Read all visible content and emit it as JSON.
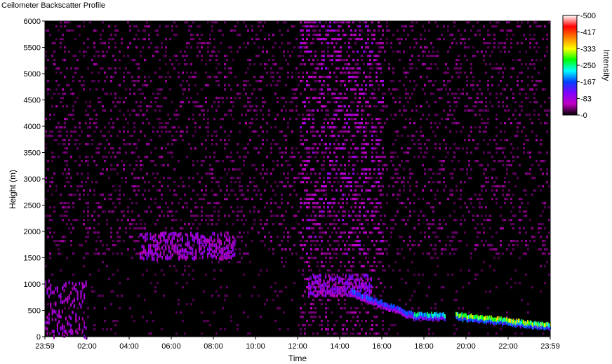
{
  "window": {
    "title": "Ceilometer Backscatter Profile"
  },
  "chart_data": {
    "type": "heatmap",
    "xlabel": "Time",
    "ylabel": "Height (m)",
    "x_ticks": [
      "23:59",
      "02:00",
      "04:00",
      "06:00",
      "08:00",
      "10:00",
      "12:00",
      "14:00",
      "16:00",
      "18:00",
      "20:00",
      "22:00",
      "23:59"
    ],
    "y_ticks": [
      0,
      500,
      1000,
      1500,
      2000,
      2500,
      3000,
      3500,
      4000,
      4500,
      5000,
      5500,
      6000
    ],
    "ylim": [
      0,
      6000
    ],
    "xlim_hours": [
      0,
      24
    ],
    "colorbar": {
      "label": "Intensity",
      "ticks": [
        0,
        83,
        167,
        250,
        333,
        417,
        500
      ],
      "range": [
        0,
        500
      ],
      "colors": [
        "#000000",
        "#c000c0",
        "#8000ff",
        "#0040ff",
        "#00ffff",
        "#00ff00",
        "#ffff00",
        "#ff8000",
        "#ff0000",
        "#ffffff"
      ]
    },
    "cloud_layers": [
      {
        "start_hour": 14.5,
        "end_hour": 17.5,
        "height_start": 900,
        "height_end": 450,
        "intensity": 160
      },
      {
        "start_hour": 17.5,
        "end_hour": 19.0,
        "height_start": 450,
        "height_end": 450,
        "intensity": 220
      },
      {
        "start_hour": 19.5,
        "end_hour": 24.0,
        "height_start": 450,
        "height_end": 250,
        "intensity": 300
      }
    ],
    "aerosol_layers": [
      {
        "start_hour": 0.0,
        "end_hour": 2.0,
        "height_min": 0,
        "height_max": 1100,
        "intensity": 90
      },
      {
        "start_hour": 4.5,
        "end_hour": 9.0,
        "height_min": 1500,
        "height_max": 2000,
        "intensity": 100
      },
      {
        "start_hour": 12.5,
        "end_hour": 15.5,
        "height_min": 800,
        "height_max": 1200,
        "intensity": 110
      }
    ]
  }
}
